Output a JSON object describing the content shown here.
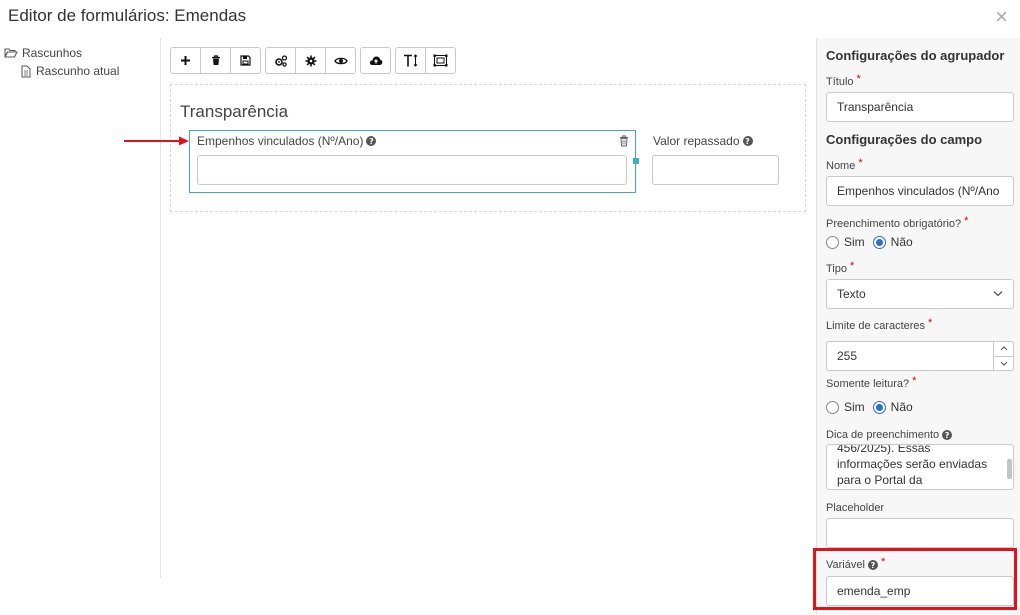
{
  "modal": {
    "title": "Editor de formulários: Emendas",
    "close_symbol": "×"
  },
  "tree": {
    "root_label": "Rascunhos",
    "root_icon": "folder-open-icon",
    "child_label": "Rascunho atual",
    "child_icon": "file-icon"
  },
  "toolbar": {
    "groups": [
      [
        "plus-icon",
        "trash-icon",
        "save-icon"
      ],
      [
        "cogs-icon",
        "gear-icon",
        "eye-icon"
      ],
      [
        "cloud-upload-icon"
      ],
      [
        "text-height-icon",
        "object-group-icon"
      ]
    ]
  },
  "canvas": {
    "group_title": "Transparência",
    "fields": [
      {
        "label": "Empenhos vinculados (Nº/Ano)",
        "value": ""
      },
      {
        "label": "Valor repassado",
        "value": ""
      }
    ]
  },
  "panel": {
    "group_header": "Configurações do agrupador",
    "title_label": "Título",
    "title_value": "Transparência",
    "field_header": "Configurações do campo",
    "name_label": "Nome",
    "name_value": "Empenhos vinculados (Nº/Ano",
    "required_label": "Preenchimento obrigatório?",
    "required_options": [
      "Sim",
      "Não"
    ],
    "required_selected": "Não",
    "type_label": "Tipo",
    "type_value": "Texto",
    "limit_label": "Limite de caracteres",
    "limit_value": "255",
    "readonly_label": "Somente leitura?",
    "readonly_options": [
      "Sim",
      "Não"
    ],
    "readonly_selected": "Não",
    "hint_label": "Dica de preenchimento",
    "hint_lines": [
      "456/2025). Essas",
      "informações serão enviadas",
      "para o Portal da"
    ],
    "placeholder_label": "Placeholder",
    "placeholder_value": "",
    "variable_label": "Variável",
    "variable_value": "emenda_emp",
    "required_mark": "*"
  },
  "colors": {
    "accent": "#2a6fd6",
    "selection": "#4aa6b6",
    "highlight": "#e0121b"
  }
}
